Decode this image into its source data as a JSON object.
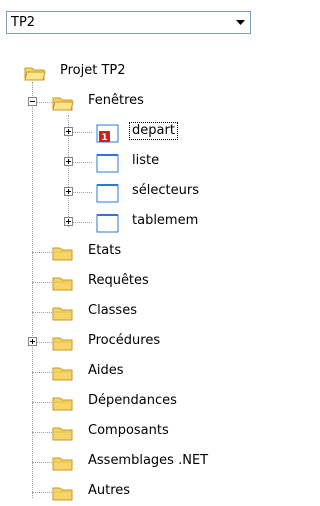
{
  "project_selector": {
    "value": "TP2",
    "arrow_icon": "dropdown-arrow-icon"
  },
  "tree": {
    "root": "Projet TP2",
    "windows_folder": "Fenêtres",
    "windows": [
      "depart",
      "liste",
      "sélecteurs",
      "tablemem"
    ],
    "folders": [
      "Etats",
      "Requêtes",
      "Classes",
      "Procédures",
      "Aides",
      "Dépendances",
      "Composants",
      "Assemblages .NET",
      "Autres"
    ]
  },
  "colors": {
    "folder_yellow": "#f7d46a",
    "folder_border": "#c69a1f",
    "window_icon_border": "#2e77d8",
    "depart_badge_red": "#d01f1f"
  }
}
